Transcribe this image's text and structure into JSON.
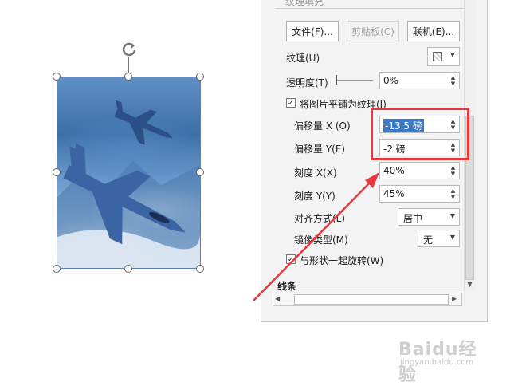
{
  "pane": {
    "top_cut_label": "纹理填充",
    "buttons": {
      "file": "文件(F)...",
      "clipboard": "剪贴板(C)",
      "online": "联机(E)..."
    },
    "texture_label": "纹理(U)",
    "transparency": {
      "label": "透明度(T)",
      "value": "0%"
    },
    "tile_checkbox": {
      "label": "将图片平铺为纹理(I)",
      "checked": true
    },
    "offset_x": {
      "label": "偏移量 X (O)",
      "value": "-13.5 磅",
      "selected": true
    },
    "offset_y": {
      "label": "偏移量 Y(E)",
      "value": "-2 磅"
    },
    "scale_x": {
      "label": "刻度 X(X)",
      "value": "40%"
    },
    "scale_y": {
      "label": "刻度 Y(Y)",
      "value": "45%"
    },
    "alignment": {
      "label": "对齐方式(L)",
      "value": "居中"
    },
    "mirror": {
      "label": "镜像类型(M)",
      "value": "无"
    },
    "rotate_checkbox": {
      "label": "与形状一起旋转(W)",
      "checked": true
    },
    "line_section": "线条"
  },
  "watermark": {
    "brand": "Baidu经验",
    "url": "jingyan.baidu.com"
  },
  "colors": {
    "highlight_red": "#e8383d",
    "selection_blue": "#3c78c3",
    "pane_bg": "#f3f3f3"
  },
  "icons": [
    "rotate-handle-icon",
    "texture-icon",
    "checkmark-icon",
    "spin-up-icon",
    "spin-down-icon",
    "chevron-down-icon",
    "scroll-left-icon",
    "scroll-right-icon",
    "scroll-down-icon",
    "red-arrow-icon",
    "jet-fighter-icon"
  ]
}
